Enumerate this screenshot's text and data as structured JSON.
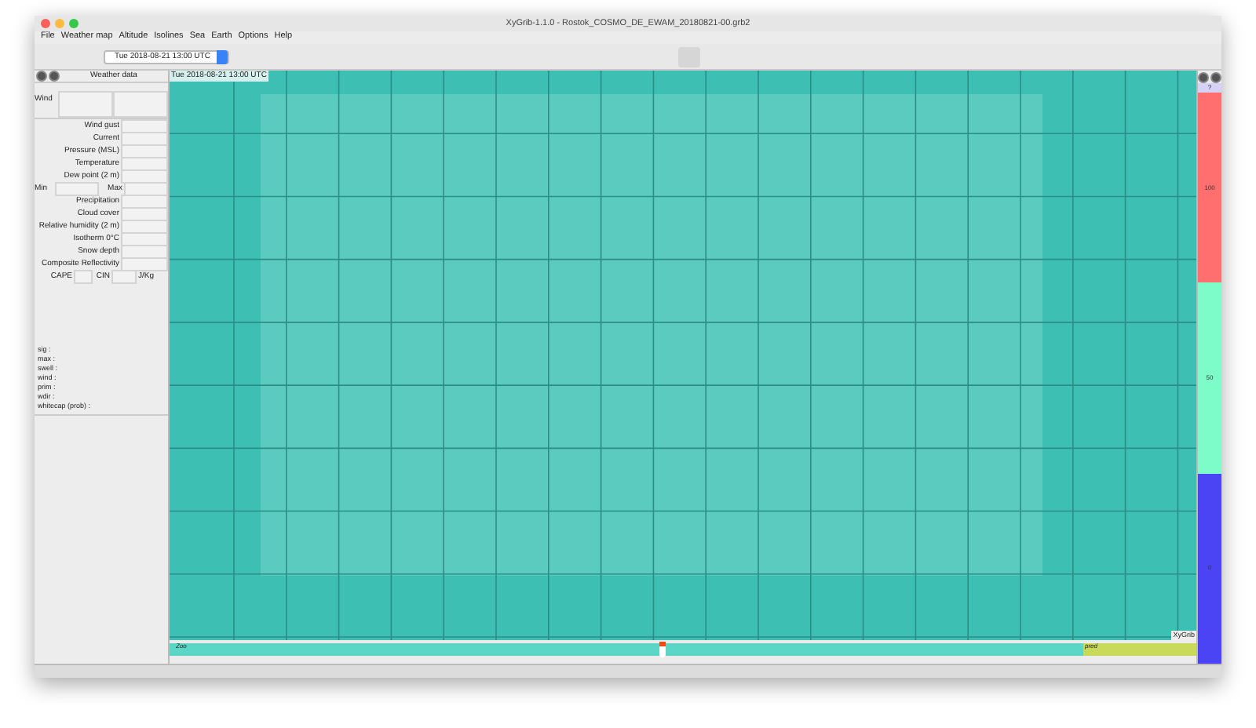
{
  "window": {
    "title": "XyGrib-1.1.0 - Rostok_COSMO_DE_EWAM_20180821-00.grb2"
  },
  "menu": [
    "File",
    "Weather map",
    "Altitude",
    "Isolines",
    "Sea",
    "Earth",
    "Options",
    "Help"
  ],
  "toolbar": {
    "date_select": "Tue 2018-08-21 13:00 UTC"
  },
  "weather_panel": {
    "title": "Weather data",
    "rows": [
      {
        "kind": "wind",
        "label": "Wind"
      },
      {
        "kind": "field",
        "label": "Wind gust"
      },
      {
        "kind": "field",
        "label": "Current"
      },
      {
        "kind": "field",
        "label": "Pressure (MSL)"
      },
      {
        "kind": "field",
        "label": "Temperature"
      },
      {
        "kind": "field",
        "label": "Dew point (2 m)"
      },
      {
        "kind": "minmax",
        "label": "Min",
        "label2": "Max"
      },
      {
        "kind": "field",
        "label": "Precipitation"
      },
      {
        "kind": "field",
        "label": "Cloud cover"
      },
      {
        "kind": "field",
        "label": "Relative humidity (2 m)"
      },
      {
        "kind": "field",
        "label": "Isotherm 0°C"
      },
      {
        "kind": "field",
        "label": "Snow depth"
      },
      {
        "kind": "field",
        "label": "Composite Reflectivity"
      },
      {
        "kind": "cape",
        "label": "CAPE",
        "label2": "CIN",
        "label3": "J/Kg"
      }
    ],
    "waves": [
      "sig :",
      "max :",
      "swell :",
      "wind :",
      "prim :",
      "wdir :",
      "whitecap (prob) :"
    ]
  },
  "map": {
    "date_label": "Tue 2018-08-21 13:00 UTC",
    "credit": "XyGrib"
  },
  "timeline": {
    "start_label": "Zoo",
    "end_label": "pred",
    "level": 0.48
  },
  "color_scale": {
    "unit": "?",
    "labels": [
      "100",
      "50",
      "0"
    ]
  }
}
